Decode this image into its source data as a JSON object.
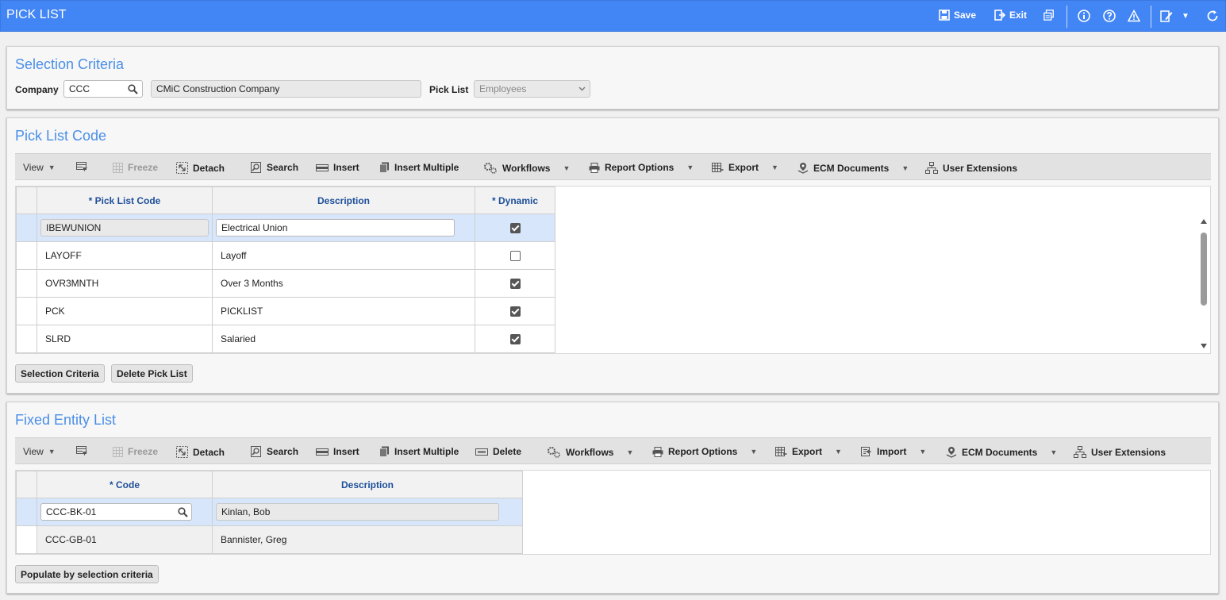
{
  "app": {
    "title": "PICK LIST",
    "save_label": "Save",
    "exit_label": "Exit"
  },
  "selection": {
    "title": "Selection Criteria",
    "company_label": "Company",
    "company_value": "CCC",
    "company_name": "CMiC Construction Company",
    "picklist_label": "Pick List",
    "picklist_value": "Employees"
  },
  "toolbar1": {
    "view": "View",
    "freeze": "Freeze",
    "detach": "Detach",
    "search": "Search",
    "insert": "Insert",
    "insert_multiple": "Insert Multiple",
    "workflows": "Workflows",
    "report_options": "Report Options",
    "export": "Export",
    "ecm_documents": "ECM Documents",
    "user_extensions": "User Extensions"
  },
  "picklist": {
    "title": "Pick List Code",
    "columns": [
      "* Pick List Code",
      "Description",
      "* Dynamic"
    ],
    "rows": [
      {
        "code": "IBEWUNION",
        "description": "Electrical Union",
        "dynamic": true
      },
      {
        "code": "LAYOFF",
        "description": "Layoff",
        "dynamic": false
      },
      {
        "code": "OVR3MNTH",
        "description": "Over 3 Months",
        "dynamic": true
      },
      {
        "code": "PCK",
        "description": "PICKLIST",
        "dynamic": true
      },
      {
        "code": "SLRD",
        "description": "Salaried",
        "dynamic": true
      }
    ],
    "btn_selection": "Selection Criteria",
    "btn_delete": "Delete Pick List"
  },
  "toolbar2": {
    "view": "View",
    "freeze": "Freeze",
    "detach": "Detach",
    "search": "Search",
    "insert": "Insert",
    "insert_multiple": "Insert Multiple",
    "delete": "Delete",
    "workflows": "Workflows",
    "report_options": "Report Options",
    "export": "Export",
    "import": "Import",
    "ecm_documents": "ECM Documents",
    "user_extensions": "User Extensions"
  },
  "fixed": {
    "title": "Fixed Entity List",
    "columns": [
      "* Code",
      "Description"
    ],
    "rows": [
      {
        "code": "CCC-BK-01",
        "description": "Kinlan, Bob"
      },
      {
        "code": "CCC-GB-01",
        "description": "Bannister, Greg"
      }
    ],
    "btn_populate": "Populate by selection criteria"
  },
  "colors": {
    "topbar": "#4285f4",
    "title_blue": "#4a8fe8",
    "header_text": "#1d4f9a",
    "selected_row": "#d7e6fb"
  }
}
